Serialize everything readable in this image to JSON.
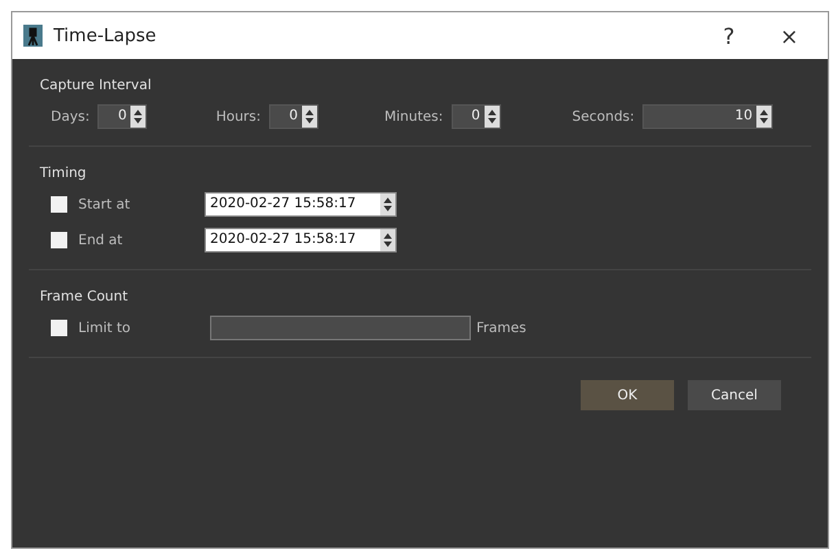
{
  "window": {
    "title": "Time-Lapse",
    "help": "?",
    "close": "×"
  },
  "capture_interval": {
    "title": "Capture Interval",
    "fields": [
      {
        "label": "Days:",
        "value": "0",
        "kind": "small"
      },
      {
        "label": "Hours:",
        "value": "0",
        "kind": "small"
      },
      {
        "label": "Minutes:",
        "value": "0",
        "kind": "small"
      },
      {
        "label": "Seconds:",
        "value": "10",
        "kind": "wide"
      }
    ]
  },
  "timing": {
    "title": "Timing",
    "rows": [
      {
        "label": "Start at",
        "checked": false,
        "value": "2020-02-27 15:58:17"
      },
      {
        "label": "End at",
        "checked": false,
        "value": "2020-02-27 15:58:17"
      }
    ]
  },
  "frame_count": {
    "title": "Frame Count",
    "label": "Limit to",
    "checked": false,
    "unit": "Frames"
  },
  "buttons": [
    {
      "label": "OK",
      "kind": "primary"
    },
    {
      "label": "Cancel",
      "kind": "secondary"
    }
  ]
}
